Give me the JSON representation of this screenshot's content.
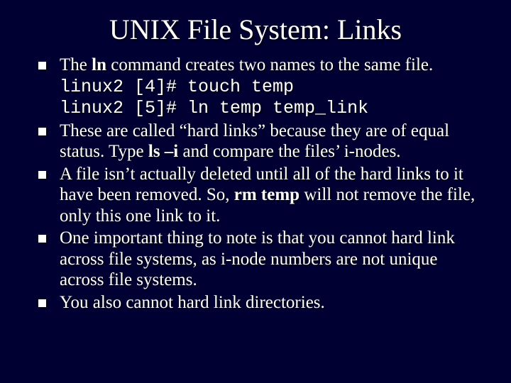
{
  "title": "UNIX File System: Links",
  "bullets": {
    "b1_pre": "The ",
    "b1_ln": "ln",
    "b1_post": " command creates two names to the same file.",
    "b1_code1": "linux2 [4]# touch temp",
    "b1_code2": "linux2 [5]# ln temp temp_link",
    "b2_pre": "These are called “hard links” because they are of equal status.  Type ",
    "b2_cmd": "ls –i",
    "b2_post": " and compare the files’ i-nodes.",
    "b3_pre": "A file isn’t actually deleted until all of the hard links to it have been removed.  So, ",
    "b3_cmd": "rm temp",
    "b3_post": " will not remove the file, only this one link to it.",
    "b4": "One important thing to note is that you cannot hard link across file systems, as i-node numbers are not unique across file systems.",
    "b5": "You also cannot hard link directories."
  }
}
